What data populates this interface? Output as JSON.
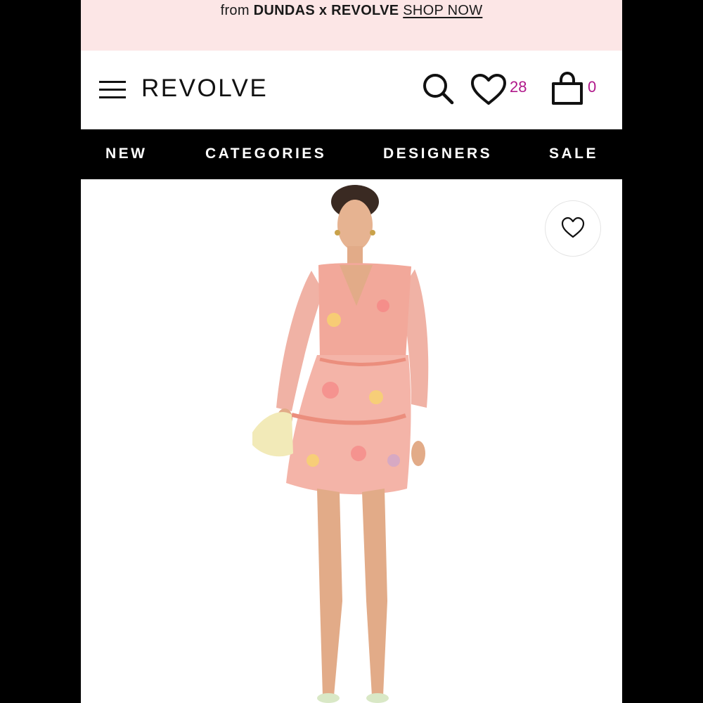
{
  "promo": {
    "prefix": "from",
    "brands": "DUNDAS x REVOLVE",
    "cta": "SHOP NOW"
  },
  "header": {
    "logo": "REVOLVE",
    "wishlist_count": "28",
    "cart_count": "0"
  },
  "nav": {
    "items": [
      "NEW",
      "CATEGORIES",
      "DESIGNERS",
      "SALE"
    ]
  },
  "icons": {
    "menu": "hamburger-menu-icon",
    "search": "search-icon",
    "wishlist": "heart-icon",
    "cart": "shopping-bag-icon",
    "favorite": "heart-outline-icon"
  },
  "colors": {
    "promo_bg": "#fce6e6",
    "count_accent": "#b0188a",
    "nav_bg": "#000000"
  }
}
